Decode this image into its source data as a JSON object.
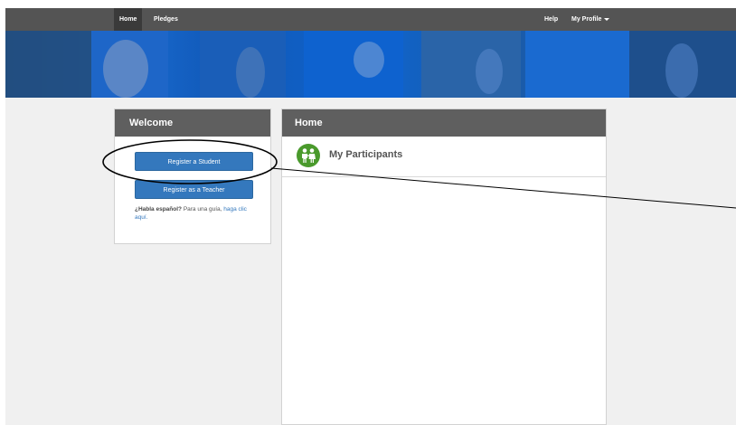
{
  "nav": {
    "home": "Home",
    "pledges": "Pledges",
    "help": "Help",
    "profile": "My Profile"
  },
  "welcome": {
    "title": "Welcome",
    "register_student": "Register a Student",
    "register_teacher": "Register as a Teacher",
    "habla_bold": "¿Habla español?",
    "habla_text": " Para una guía, ",
    "habla_link": "haga clic aquí."
  },
  "home": {
    "title": "Home",
    "participants": "My Participants"
  },
  "icons": {
    "participants": "children-icon",
    "profile_caret": "chevron-down-icon"
  },
  "colors": {
    "navbar": "#545454",
    "panel_header": "#5f5f5f",
    "button": "#3478bd",
    "participants_icon": "#4a9a2c"
  }
}
